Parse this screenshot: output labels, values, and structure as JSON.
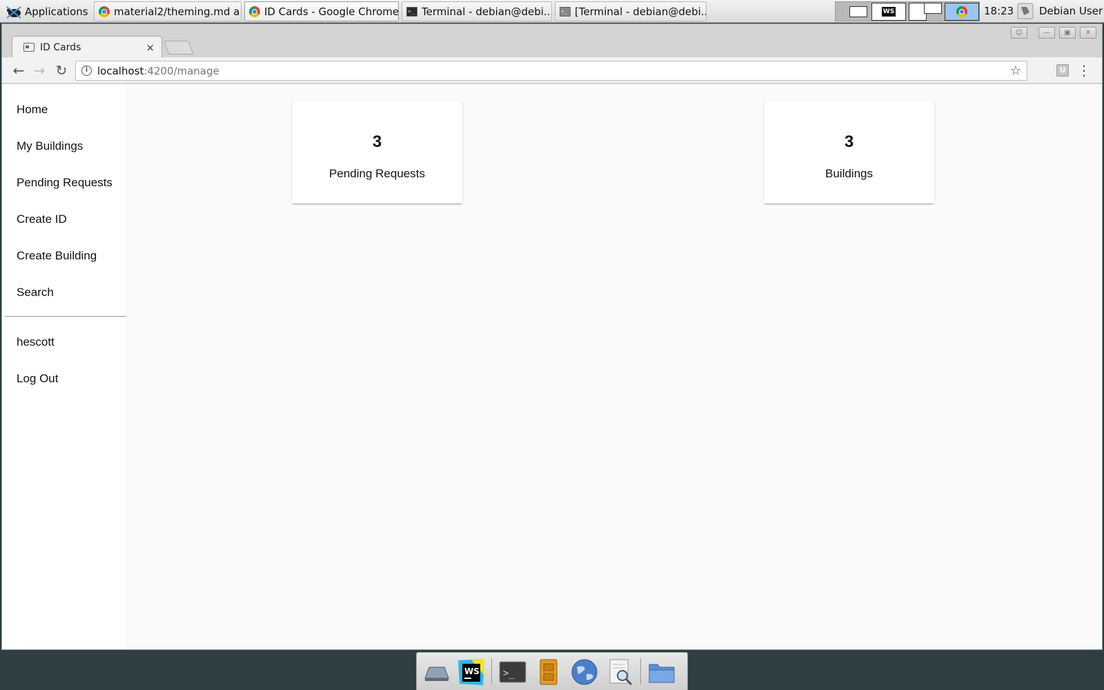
{
  "taskbar": {
    "apps_label": "Applications",
    "tasks": [
      {
        "label": "material2/theming.md a...",
        "icon": "chrome-icon"
      },
      {
        "label": "ID Cards - Google Chrome",
        "icon": "chrome-icon"
      },
      {
        "label": "Terminal - debian@debi...",
        "icon": "terminal-icon"
      },
      {
        "label": "[Terminal - debian@debi...",
        "icon": "terminal-icon"
      }
    ],
    "workspace_tag": "WS",
    "clock": "18:23",
    "user": "Debian User"
  },
  "browser": {
    "tab_title": "ID Cards",
    "tab_close": "×",
    "url_host": "localhost",
    "url_path": ":4200/manage",
    "ext_label": "U"
  },
  "sidenav": {
    "items": [
      {
        "label": "Home"
      },
      {
        "label": "My Buildings"
      },
      {
        "label": "Pending Requests"
      },
      {
        "label": "Create ID"
      },
      {
        "label": "Create Building"
      },
      {
        "label": "Search"
      }
    ],
    "account": [
      {
        "label": "hescott"
      },
      {
        "label": "Log Out"
      }
    ]
  },
  "cards": [
    {
      "count": "3",
      "label": "Pending Requests"
    },
    {
      "count": "3",
      "label": "Buildings"
    }
  ],
  "colors": {
    "taskbar_bg": "#e6e6e6",
    "page_bg": "#fafafa",
    "sidenav_bg": "#ffffff",
    "desktop_bg": "#2f3f41",
    "active_workspace": "#9cc4ec"
  }
}
